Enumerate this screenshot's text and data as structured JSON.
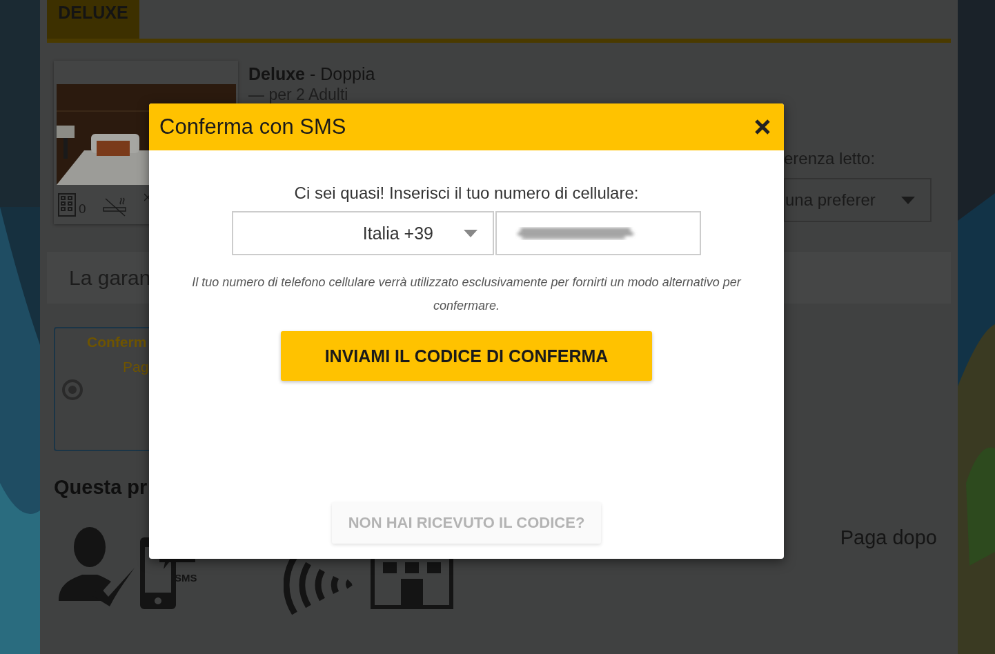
{
  "background": {
    "tabs": [
      {
        "label": "DELUXE",
        "selected": true
      }
    ],
    "room": {
      "title": "**Deluxe** - Doppia",
      "occupancy": "— per 2 Adulti",
      "amenities": [
        {
          "kind": "rooms",
          "count": "0"
        },
        {
          "kind": "no_smoking"
        },
        {
          "kind": "cross"
        }
      ]
    },
    "bed_preference": {
      "label": "erenza letto:",
      "value": "una preferer"
    },
    "guarantee": {
      "title": "La garan"
    },
    "options": [
      {
        "title": "Conferm",
        "subtitle": "Pag",
        "selected": true
      }
    ],
    "features_title": "Questa pr",
    "features": [
      {
        "kind": "person_check"
      },
      {
        "kind": "phone_sms",
        "label": "SMS"
      },
      {
        "kind": "signal"
      },
      {
        "kind": "building"
      }
    ],
    "payment_note": "Paga dopo"
  },
  "modal": {
    "title": "Conferma con SMS",
    "prompt": "Ci sei quasi! Inserisci il tuo numero di cellulare:",
    "country": "Italia +39",
    "note": "Il tuo numero di telefono cellulare verrà utilizzato esclusivamente per fornirti un modo alternativo per confermare.",
    "send_button": "INVIAMI IL CODICE DI CONFERMA",
    "resend_button": "NON HAI RICEVUTO IL CODICE?"
  }
}
